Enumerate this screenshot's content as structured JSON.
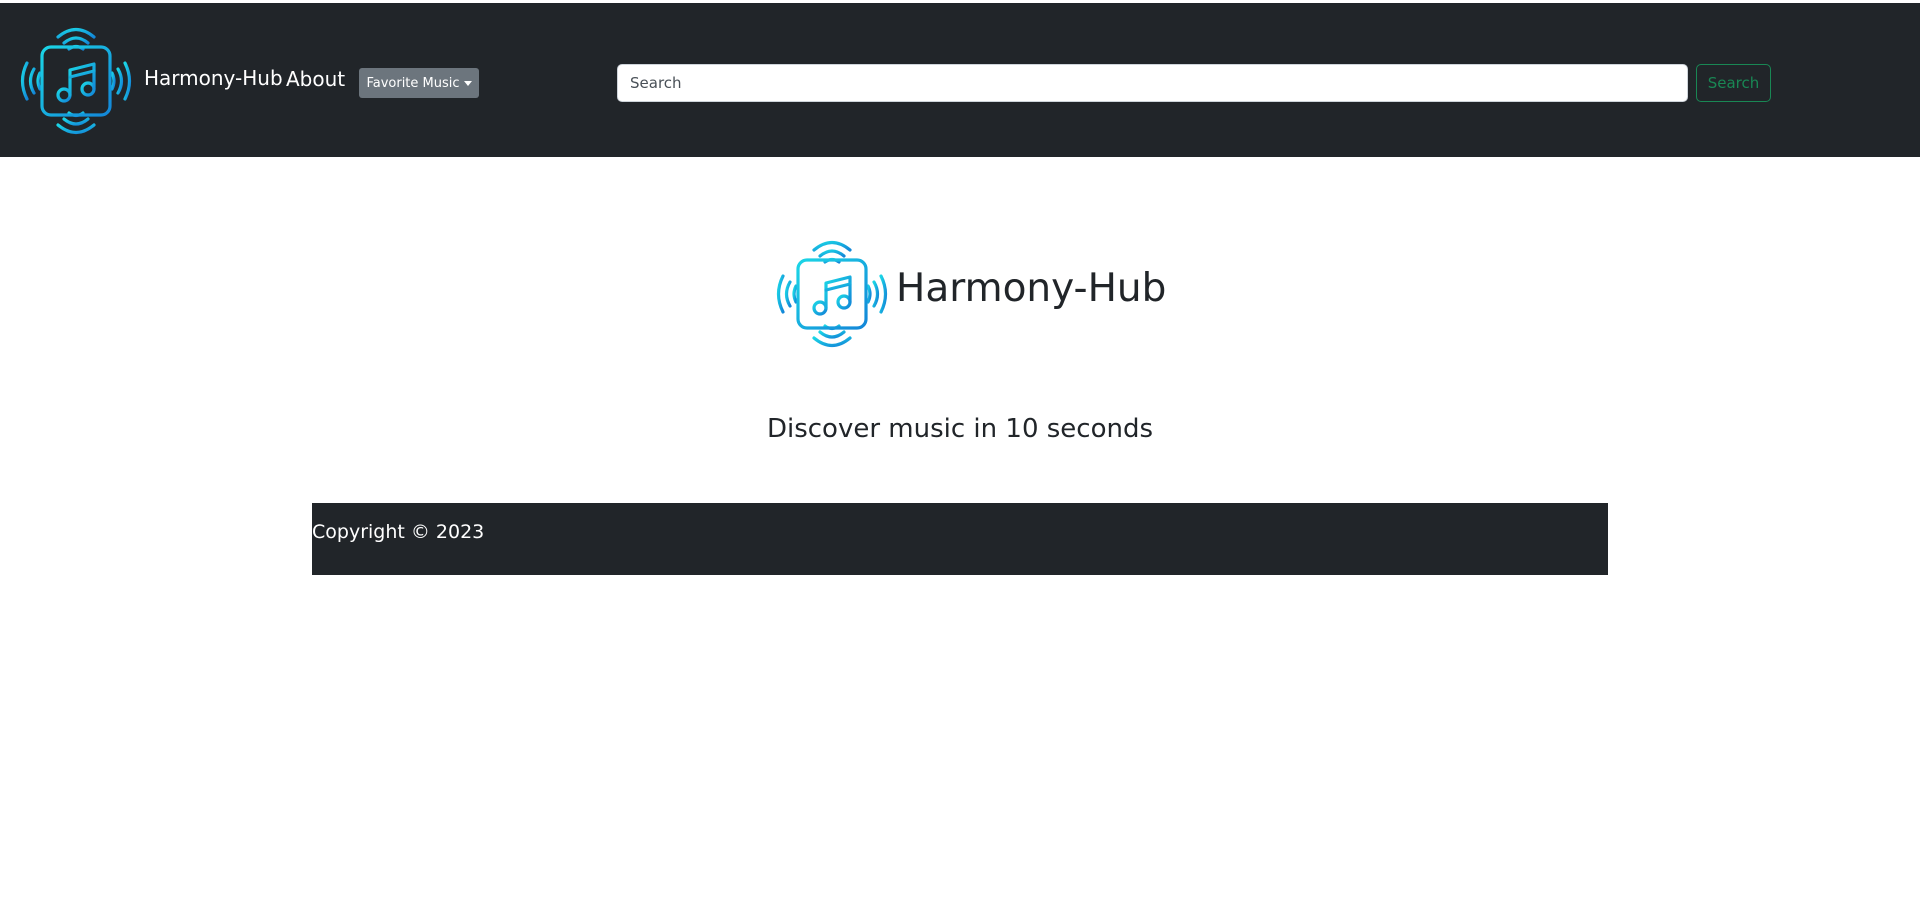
{
  "navbar": {
    "brand": "Harmony-Hub",
    "about_label": "About",
    "favorite_music_label": "Favorite Music",
    "search": {
      "placeholder": "Search",
      "value": "",
      "button_label": "Search"
    }
  },
  "main": {
    "title": "Harmony-Hub",
    "tagline": "Discover music in 10 seconds"
  },
  "footer": {
    "copyright": "Copyright © 2023"
  },
  "icons": {
    "logo": "music-note-speaker-icon",
    "dropdown": "caret-down-icon"
  },
  "colors": {
    "navbar_bg": "#212529",
    "logo_gradient_start": "#1bd6e6",
    "logo_gradient_end": "#1386d8",
    "search_button": "#198754",
    "dropdown_button": "#6c757d"
  }
}
